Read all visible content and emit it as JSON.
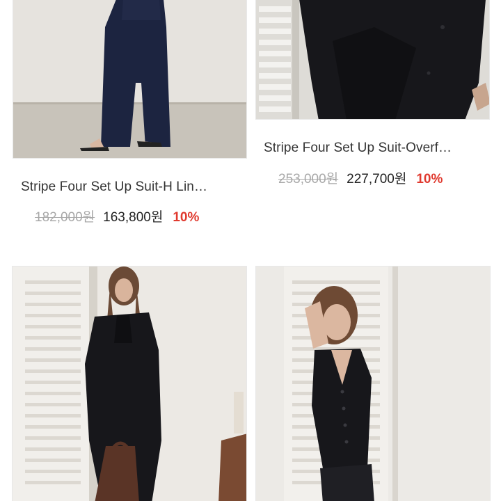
{
  "products": [
    {
      "title": "Stripe Four Set Up Suit-H Lin…",
      "original_price": "182,000원",
      "sale_price": "163,800원",
      "discount": "10%",
      "image_alt": "model-wide-navy-trousers"
    },
    {
      "title": "Stripe Four Set Up Suit-Overf…",
      "original_price": "253,000원",
      "sale_price": "227,700원",
      "discount": "10%",
      "image_alt": "model-black-jacket"
    },
    {
      "title": "",
      "image_alt": "model-black-suit-with-bag"
    },
    {
      "title": "",
      "image_alt": "model-black-vest"
    }
  ],
  "colors": {
    "discount": "#e03a2f",
    "original_price": "#a8a8a8",
    "suit_black": "#17171b",
    "navy": "#1c2440"
  }
}
